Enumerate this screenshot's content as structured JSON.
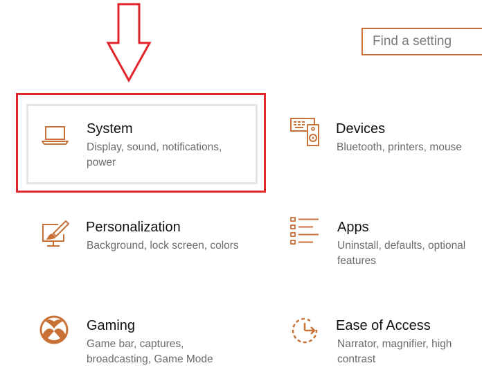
{
  "search": {
    "placeholder": "Find a setting"
  },
  "tiles": [
    {
      "title": "System",
      "description": "Display, sound, notifications, power",
      "icon": "laptop-icon"
    },
    {
      "title": "Devices",
      "description": "Bluetooth, printers, mouse",
      "icon": "keyboard-speaker-icon"
    },
    {
      "title": "Personalization",
      "description": "Background, lock screen, colors",
      "icon": "paintbrush-monitor-icon"
    },
    {
      "title": "Apps",
      "description": "Uninstall, defaults, optional features",
      "icon": "apps-list-icon"
    },
    {
      "title": "Gaming",
      "description": "Game bar, captures, broadcasting, Game Mode",
      "icon": "xbox-icon"
    },
    {
      "title": "Ease of Access",
      "description": "Narrator, magnifier, high contrast",
      "icon": "ease-of-access-icon"
    }
  ],
  "colors": {
    "accent": "#c87137",
    "highlight": "#e1252b",
    "title_text": "#111111",
    "desc_text": "#6b6b6b"
  }
}
